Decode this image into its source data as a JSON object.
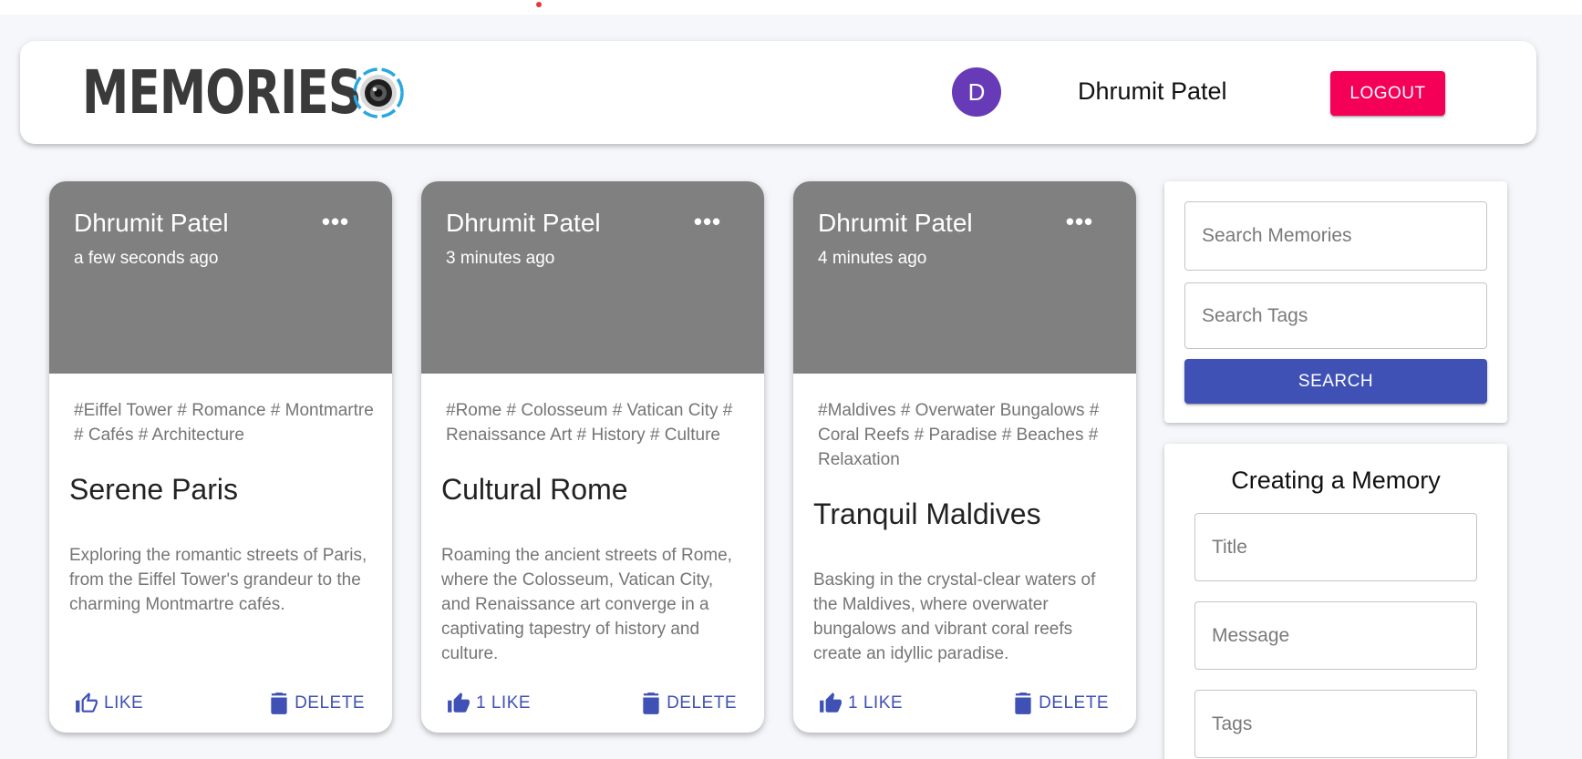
{
  "appbar": {
    "brand": "MEMORIES",
    "brand_icon": "camera-lens-icon",
    "avatar_initial": "D",
    "user_name": "Dhrumit Patel",
    "logout_label": "LOGOUT"
  },
  "colors": {
    "accent": "#3f51b5",
    "logout": "#f50057",
    "avatar": "#673ab7",
    "media_placeholder": "#808080"
  },
  "posts": [
    {
      "author": "Dhrumit Patel",
      "time": "a few seconds ago",
      "more_icon": "more-horiz-icon",
      "tags": "#Eiffel Tower # Romance # Montmartre # Cafés # Architecture",
      "title": "Serene Paris",
      "message": "Exploring the romantic streets of Paris, from the Eiffel Tower's grandeur to the charming Montmartre cafés.",
      "like_label": "LIKE",
      "like_icon": "thumb-up-outline-icon",
      "delete_label": "DELETE",
      "delete_icon": "trash-icon"
    },
    {
      "author": "Dhrumit Patel",
      "time": "3 minutes ago",
      "more_icon": "more-horiz-icon",
      "tags": "#Rome # Colosseum # Vatican City # Renaissance Art # History # Culture",
      "title": "Cultural Rome",
      "message": "Roaming the ancient streets of Rome, where the Colosseum, Vatican City, and Renaissance art converge in a captivating tapestry of history and culture.",
      "like_label": "1 LIKE",
      "like_icon": "thumb-up-filled-icon",
      "delete_label": "DELETE",
      "delete_icon": "trash-icon"
    },
    {
      "author": "Dhrumit Patel",
      "time": "4 minutes ago",
      "more_icon": "more-horiz-icon",
      "tags": "#Maldives # Overwater Bungalows # Coral Reefs # Paradise # Beaches # Relaxation",
      "title": "Tranquil Maldives",
      "message": "Basking in the crystal-clear waters of the Maldives, where overwater bungalows and vibrant coral reefs create an idyllic paradise.",
      "like_label": "1 LIKE",
      "like_icon": "thumb-up-filled-icon",
      "delete_label": "DELETE",
      "delete_icon": "trash-icon"
    }
  ],
  "search": {
    "memories_placeholder": "Search Memories",
    "tags_placeholder": "Search Tags",
    "button_label": "SEARCH"
  },
  "form": {
    "heading": "Creating a Memory",
    "title_placeholder": "Title",
    "message_placeholder": "Message",
    "tags_placeholder": "Tags"
  }
}
